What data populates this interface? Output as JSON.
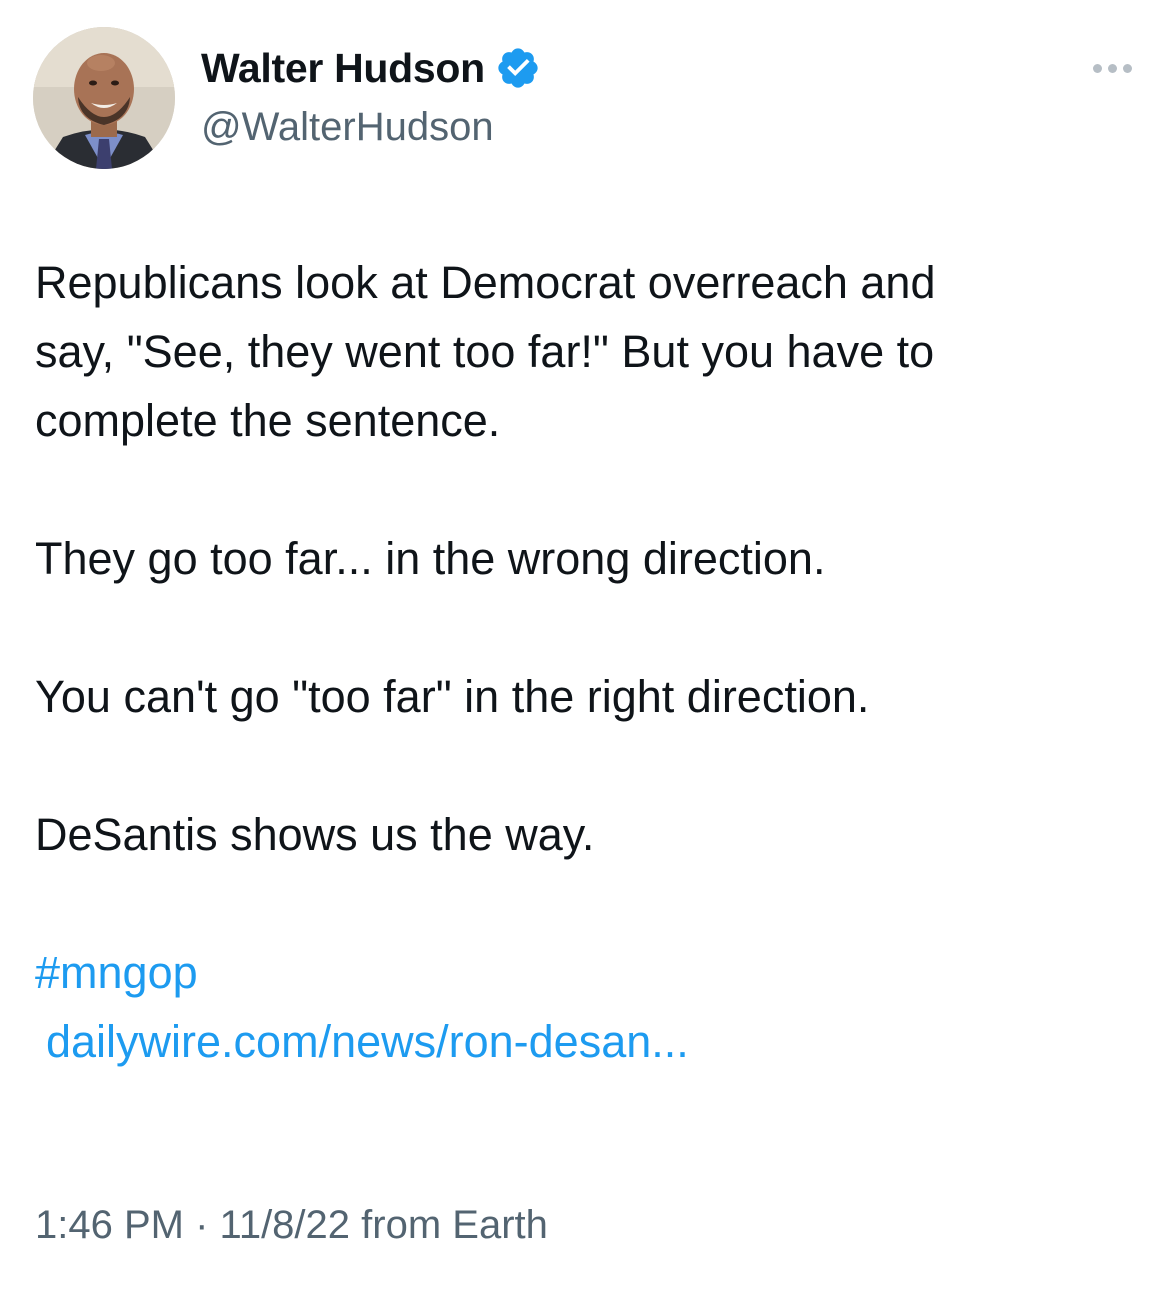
{
  "user": {
    "display_name": "Walter Hudson",
    "handle": "@WalterHudson",
    "verified": true,
    "verified_color": "#1d9bf0"
  },
  "menu": {
    "icon": "more-horizontal-icon"
  },
  "tweet": {
    "paragraphs": [
      "Republicans look at Democrat overreach and\nsay, \"See, they went too far!\" But you have to\ncomplete the sentence.",
      "They go too far... in the wrong direction.",
      "You can't go \"too far\" in the right direction.",
      "DeSantis shows us the way."
    ],
    "hashtag": "#mngop",
    "link": "dailywire.com/news/ron-desan..."
  },
  "meta": {
    "time": "1:46 PM",
    "separator": "·",
    "date": "11/8/22",
    "source": "from Earth"
  },
  "colors": {
    "link": "#1d9bf0",
    "secondary_text": "#536471",
    "primary_text": "#0f1419"
  }
}
